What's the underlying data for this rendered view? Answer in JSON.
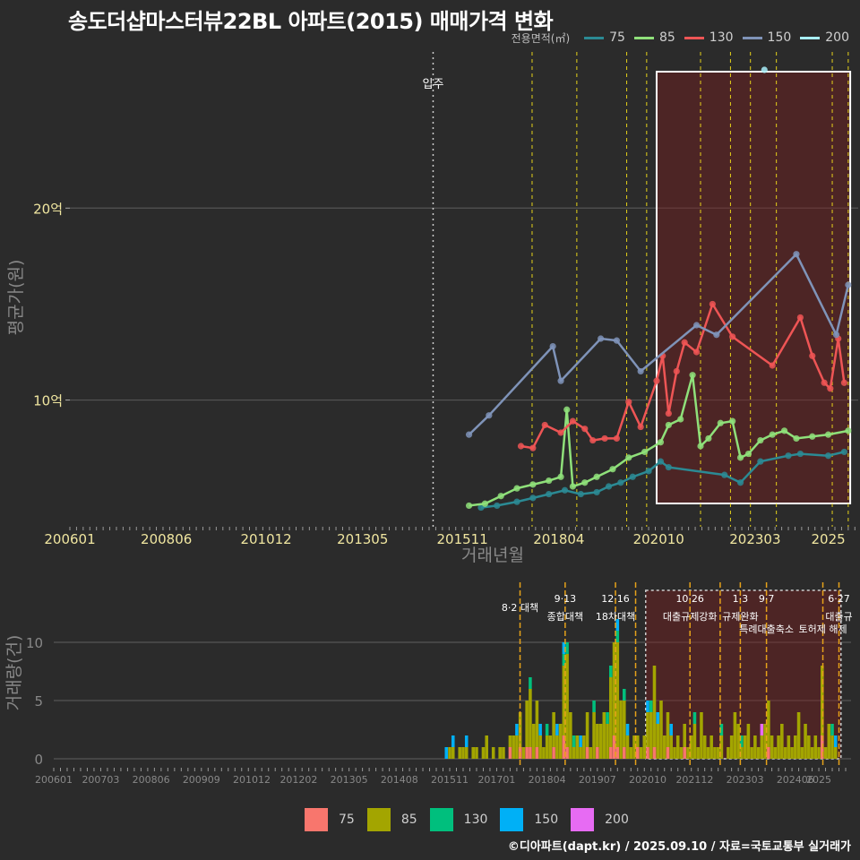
{
  "title": "송도더샵마스터뷰22BL 아파트(2015) 매매가격 변화",
  "caption": "©디아파트(dapt.kr) / 2025.09.10 / 자료=국토교통부 실거래가",
  "legend_top": {
    "title": "전용면적(㎡)",
    "items": [
      {
        "label": "75",
        "color": "#2b8a94"
      },
      {
        "label": "85",
        "color": "#8fe07a"
      },
      {
        "label": "130",
        "color": "#ee5555"
      },
      {
        "label": "150",
        "color": "#7f93b8"
      },
      {
        "label": "200",
        "color": "#a8eefa"
      }
    ]
  },
  "legend_bottom": {
    "items": [
      {
        "label": "75",
        "color": "#f8766d"
      },
      {
        "label": "85",
        "color": "#a3a500"
      },
      {
        "label": "130",
        "color": "#00bf7d"
      },
      {
        "label": "150",
        "color": "#00b0f6"
      },
      {
        "label": "200",
        "color": "#e76bf3"
      }
    ]
  },
  "chart_data": [
    {
      "type": "line",
      "title": "송도더샵마스터뷰22BL 아파트(2015) 매매가격 변화",
      "xlabel": "거래년월",
      "ylabel": "평균가(원)",
      "x_ticks": [
        "200601",
        "200806",
        "201012",
        "201305",
        "201511",
        "201804",
        "202010",
        "202303",
        "2025"
      ],
      "y_ticks": [
        {
          "value": 10,
          "label": "10억"
        },
        {
          "value": 20,
          "label": "20억"
        }
      ],
      "xlim": [
        2006.0,
        2025.75
      ],
      "ylim": [
        3.4,
        28.6
      ],
      "y_unit": "억원",
      "grid": true,
      "legend_position": "top-right",
      "annotation": {
        "label": "입주",
        "x": 2015.1
      },
      "highlight_period": [
        2020.7,
        2025.55
      ],
      "series": [
        {
          "name": "75",
          "color": "#2b8a94",
          "x": [
            2016.3,
            2016.7,
            2017.2,
            2017.6,
            2018.0,
            2018.4,
            2018.8,
            2019.2,
            2019.5,
            2019.8,
            2020.1,
            2020.5,
            2020.8,
            2021.0,
            2022.4,
            2022.8,
            2023.3,
            2024.0,
            2024.3,
            2025.0,
            2025.4
          ],
          "y": [
            4.4,
            4.5,
            4.7,
            4.9,
            5.1,
            5.3,
            5.1,
            5.2,
            5.5,
            5.7,
            6.0,
            6.3,
            6.8,
            6.5,
            6.1,
            5.7,
            6.8,
            7.1,
            7.2,
            7.1,
            7.3
          ]
        },
        {
          "name": "85",
          "color": "#8fe07a",
          "x": [
            2016.0,
            2016.4,
            2016.8,
            2017.2,
            2017.6,
            2018.0,
            2018.3,
            2018.45,
            2018.6,
            2018.9,
            2019.2,
            2019.6,
            2020.0,
            2020.4,
            2020.8,
            2021.0,
            2021.3,
            2021.6,
            2021.8,
            2022.0,
            2022.3,
            2022.6,
            2022.8,
            2023.0,
            2023.3,
            2023.6,
            2023.9,
            2024.2,
            2024.6,
            2025.0,
            2025.5
          ],
          "y": [
            4.5,
            4.6,
            5.0,
            5.4,
            5.6,
            5.8,
            6.0,
            9.5,
            5.5,
            5.7,
            6.0,
            6.4,
            7.0,
            7.3,
            7.8,
            8.7,
            9.0,
            11.3,
            7.6,
            8.0,
            8.8,
            8.9,
            7.0,
            7.2,
            7.9,
            8.2,
            8.4,
            8.0,
            8.1,
            8.2,
            8.4
          ]
        },
        {
          "name": "130",
          "color": "#ee5555",
          "x": [
            2017.3,
            2017.6,
            2017.9,
            2018.3,
            2018.6,
            2018.9,
            2019.1,
            2019.4,
            2019.7,
            2020.0,
            2020.3,
            2020.7,
            2020.85,
            2021.0,
            2021.2,
            2021.4,
            2021.7,
            2022.1,
            2022.6,
            2023.6,
            2024.3,
            2024.6,
            2024.9,
            2025.05,
            2025.25,
            2025.4
          ],
          "y": [
            7.6,
            7.5,
            8.7,
            8.3,
            8.9,
            8.5,
            7.9,
            8.0,
            8.0,
            9.9,
            8.6,
            11.0,
            12.3,
            9.3,
            11.5,
            13.0,
            12.5,
            15.0,
            13.3,
            11.8,
            14.3,
            12.3,
            10.9,
            10.6,
            13.2,
            10.9
          ]
        },
        {
          "name": "150",
          "color": "#7f93b8",
          "x": [
            2016.0,
            2016.5,
            2018.1,
            2018.3,
            2019.3,
            2019.7,
            2020.3,
            2021.7,
            2022.2,
            2024.2,
            2025.2,
            2025.5
          ],
          "y": [
            8.2,
            9.2,
            12.8,
            11.0,
            13.2,
            13.1,
            11.5,
            13.9,
            13.4,
            17.6,
            13.4,
            16.0
          ]
        },
        {
          "name": "200",
          "color": "#a8eefa",
          "x": [
            2023.4
          ],
          "y": [
            27.2
          ]
        }
      ]
    },
    {
      "type": "bar",
      "xlabel": "거래년월",
      "ylabel": "거래량(건)",
      "x_ticks": [
        "200601",
        "200703",
        "200806",
        "200909",
        "201012",
        "201202",
        "201305",
        "201408",
        "201511",
        "201701",
        "201804",
        "201907",
        "202010",
        "202112",
        "202303",
        "202406",
        "2025"
      ],
      "y_ticks": [
        0,
        5,
        10
      ],
      "ylim": [
        0,
        14
      ],
      "grid": true,
      "legend_position": "bottom",
      "highlight_period": [
        2020.7,
        2025.55
      ],
      "events": [
        {
          "x": 2017.58,
          "date": "",
          "label": "8·2 대책"
        },
        {
          "x": 2018.7,
          "date": "9·13",
          "label": "종합대책"
        },
        {
          "x": 2019.95,
          "date": "12·16",
          "label": "18차대책"
        },
        {
          "x": 2020.45,
          "date": "",
          "label": ""
        },
        {
          "x": 2021.8,
          "date": "10·26",
          "label": "대출규제강화"
        },
        {
          "x": 2022.55,
          "date": "",
          "label": ""
        },
        {
          "x": 2023.05,
          "date": "1·3",
          "label": "규제완화"
        },
        {
          "x": 2023.7,
          "date": "9·7",
          "label": "특례대출축소"
        },
        {
          "x": 2025.1,
          "date": "",
          "label": "토허제 해제"
        },
        {
          "x": 2025.5,
          "date": "6·27",
          "label": "대출규"
        }
      ],
      "series": [
        {
          "name": "75",
          "color": "#f8766d"
        },
        {
          "name": "85",
          "color": "#a3a500"
        },
        {
          "name": "130",
          "color": "#00bf7d"
        },
        {
          "name": "150",
          "color": "#00b0f6"
        },
        {
          "name": "200",
          "color": "#e76bf3"
        }
      ],
      "monthly": {
        "start": 2015.75,
        "values": [
          [
            0,
            0,
            0,
            1,
            0
          ],
          [
            0,
            1,
            0,
            0,
            0
          ],
          [
            0,
            1,
            0,
            1,
            0
          ],
          [
            0,
            0,
            0,
            0,
            0
          ],
          [
            0,
            1,
            0,
            0,
            0
          ],
          [
            0,
            1,
            0,
            0,
            0
          ],
          [
            0,
            1,
            0,
            1,
            0
          ],
          [
            0,
            0,
            0,
            0,
            0
          ],
          [
            0,
            1,
            0,
            0,
            0
          ],
          [
            0,
            1,
            0,
            0,
            0
          ],
          [
            0,
            0,
            0,
            0,
            0
          ],
          [
            0,
            1,
            0,
            0,
            0
          ],
          [
            0,
            2,
            0,
            0,
            0
          ],
          [
            0,
            0,
            0,
            0,
            0
          ],
          [
            0,
            1,
            0,
            0,
            0
          ],
          [
            0,
            0,
            0,
            0,
            0
          ],
          [
            0,
            1,
            0,
            0,
            0
          ],
          [
            0,
            1,
            0,
            0,
            0
          ],
          [
            0,
            0,
            0,
            0,
            0
          ],
          [
            1,
            1,
            0,
            0,
            0
          ],
          [
            0,
            2,
            0,
            0,
            0
          ],
          [
            0,
            2,
            0,
            1,
            0
          ],
          [
            1,
            3,
            0,
            0,
            0
          ],
          [
            0,
            1,
            0,
            0,
            0
          ],
          [
            1,
            4,
            0,
            0,
            0
          ],
          [
            1,
            5,
            1,
            0,
            0
          ],
          [
            0,
            3,
            0,
            0,
            0
          ],
          [
            1,
            4,
            0,
            0,
            0
          ],
          [
            0,
            2,
            0,
            1,
            0
          ],
          [
            0,
            1,
            0,
            0,
            0
          ],
          [
            0,
            2,
            1,
            0,
            0
          ],
          [
            0,
            2,
            0,
            0,
            0
          ],
          [
            1,
            3,
            0,
            0,
            0
          ],
          [
            0,
            2,
            0,
            1,
            0
          ],
          [
            0,
            3,
            0,
            0,
            0
          ],
          [
            2,
            6,
            1,
            1,
            0
          ],
          [
            1,
            8,
            1,
            0,
            0
          ],
          [
            0,
            4,
            0,
            0,
            0
          ],
          [
            0,
            1,
            1,
            0,
            0
          ],
          [
            0,
            2,
            0,
            0,
            0
          ],
          [
            0,
            1,
            0,
            1,
            0
          ],
          [
            0,
            2,
            0,
            0,
            0
          ],
          [
            1,
            3,
            0,
            0,
            0
          ],
          [
            0,
            1,
            0,
            0,
            0
          ],
          [
            0,
            4,
            1,
            0,
            0
          ],
          [
            1,
            2,
            0,
            0,
            0
          ],
          [
            0,
            3,
            0,
            0,
            0
          ],
          [
            0,
            4,
            0,
            0,
            0
          ],
          [
            0,
            3,
            1,
            0,
            0
          ],
          [
            1,
            6,
            1,
            0,
            0
          ],
          [
            2,
            8,
            0,
            0,
            0
          ],
          [
            1,
            9,
            1,
            1,
            0
          ],
          [
            0,
            5,
            0,
            0,
            0
          ],
          [
            1,
            4,
            1,
            0,
            0
          ],
          [
            0,
            2,
            0,
            1,
            0
          ],
          [
            0,
            1,
            0,
            0,
            0
          ],
          [
            0,
            2,
            0,
            0,
            0
          ],
          [
            1,
            1,
            0,
            0,
            0
          ],
          [
            0,
            1,
            0,
            0,
            0
          ],
          [
            0,
            2,
            0,
            0,
            0
          ],
          [
            1,
            3,
            0,
            1,
            0
          ],
          [
            0,
            4,
            1,
            0,
            0
          ],
          [
            1,
            7,
            0,
            0,
            0
          ],
          [
            0,
            3,
            0,
            1,
            0
          ],
          [
            0,
            5,
            0,
            0,
            0
          ],
          [
            0,
            2,
            0,
            0,
            0
          ],
          [
            1,
            3,
            0,
            0,
            0
          ],
          [
            0,
            2,
            0,
            1,
            0
          ],
          [
            0,
            1,
            0,
            0,
            0
          ],
          [
            0,
            2,
            0,
            0,
            0
          ],
          [
            0,
            1,
            0,
            0,
            0
          ],
          [
            1,
            2,
            0,
            0,
            0
          ],
          [
            0,
            1,
            0,
            0,
            0
          ],
          [
            0,
            2,
            0,
            0,
            0
          ],
          [
            0,
            3,
            1,
            0,
            0
          ],
          [
            0,
            1,
            0,
            0,
            0
          ],
          [
            0,
            4,
            0,
            0,
            0
          ],
          [
            0,
            2,
            0,
            0,
            0
          ],
          [
            0,
            1,
            0,
            0,
            0
          ],
          [
            0,
            2,
            0,
            0,
            0
          ],
          [
            0,
            1,
            0,
            0,
            0
          ],
          [
            0,
            1,
            0,
            0,
            0
          ],
          [
            0,
            2,
            1,
            0,
            0
          ],
          [
            0,
            0,
            0,
            0,
            0
          ],
          [
            0,
            1,
            0,
            0,
            0
          ],
          [
            0,
            2,
            0,
            0,
            0
          ],
          [
            0,
            4,
            0,
            0,
            0
          ],
          [
            0,
            3,
            0,
            0,
            0
          ],
          [
            0,
            1,
            1,
            0,
            0
          ],
          [
            0,
            2,
            0,
            0,
            0
          ],
          [
            0,
            3,
            0,
            0,
            0
          ],
          [
            0,
            1,
            0,
            0,
            0
          ],
          [
            0,
            2,
            0,
            0,
            0
          ],
          [
            0,
            1,
            0,
            0,
            0
          ],
          [
            0,
            2,
            0,
            0,
            1
          ],
          [
            0,
            3,
            0,
            0,
            0
          ],
          [
            1,
            4,
            0,
            0,
            0
          ],
          [
            0,
            2,
            0,
            0,
            0
          ],
          [
            0,
            1,
            0,
            0,
            0
          ],
          [
            0,
            2,
            0,
            0,
            0
          ],
          [
            0,
            3,
            0,
            0,
            0
          ],
          [
            0,
            1,
            0,
            0,
            0
          ],
          [
            0,
            2,
            0,
            0,
            0
          ],
          [
            0,
            1,
            0,
            0,
            0
          ],
          [
            0,
            2,
            0,
            0,
            0
          ],
          [
            0,
            4,
            0,
            0,
            0
          ],
          [
            0,
            1,
            0,
            0,
            0
          ],
          [
            0,
            3,
            0,
            0,
            0
          ],
          [
            0,
            2,
            0,
            0,
            0
          ],
          [
            0,
            1,
            0,
            0,
            0
          ],
          [
            0,
            2,
            0,
            0,
            0
          ],
          [
            0,
            1,
            0,
            0,
            0
          ],
          [
            2,
            6,
            0,
            0,
            0
          ],
          [
            0,
            1,
            0,
            0,
            0
          ],
          [
            0,
            3,
            0,
            0,
            0
          ],
          [
            0,
            2,
            1,
            0,
            0
          ],
          [
            0,
            1,
            0,
            1,
            0
          ]
        ]
      }
    }
  ]
}
